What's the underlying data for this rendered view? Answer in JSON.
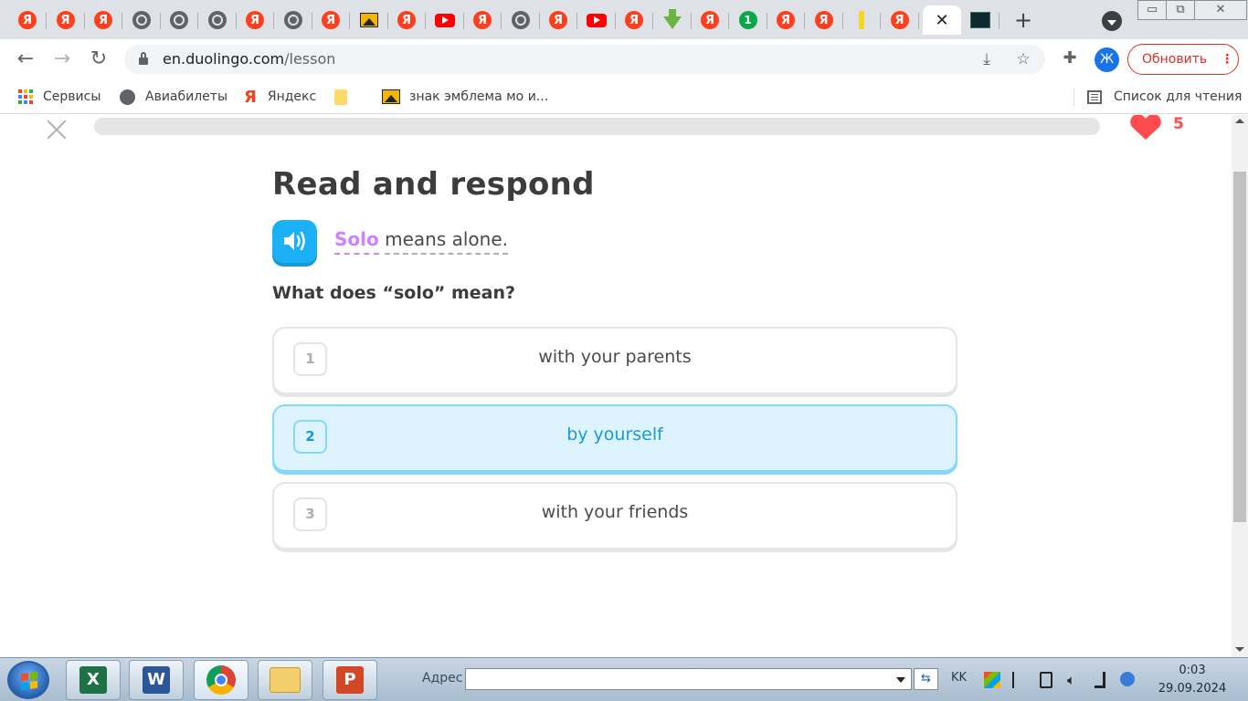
{
  "browser": {
    "tabs": [
      {
        "icon": "yandex-icon",
        "glyph": "Я"
      },
      {
        "icon": "yandex-icon",
        "glyph": "Я"
      },
      {
        "icon": "yandex-icon",
        "glyph": "Я"
      },
      {
        "icon": "globe-icon",
        "glyph": ""
      },
      {
        "icon": "globe-icon",
        "glyph": ""
      },
      {
        "icon": "globe-icon",
        "glyph": ""
      },
      {
        "icon": "yandex-icon",
        "glyph": "Я"
      },
      {
        "icon": "globe-icon",
        "glyph": ""
      },
      {
        "icon": "yandex-icon",
        "glyph": "Я"
      },
      {
        "icon": "image-icon",
        "glyph": ""
      },
      {
        "icon": "yandex-icon",
        "glyph": "Я"
      },
      {
        "icon": "youtube-icon",
        "glyph": ""
      },
      {
        "icon": "yandex-icon",
        "glyph": "Я"
      },
      {
        "icon": "globe-icon",
        "glyph": ""
      },
      {
        "icon": "yandex-icon",
        "glyph": "Я"
      },
      {
        "icon": "youtube-icon",
        "glyph": ""
      },
      {
        "icon": "yandex-icon",
        "glyph": "Я"
      },
      {
        "icon": "download-icon",
        "glyph": ""
      },
      {
        "icon": "yandex-icon",
        "glyph": "Я"
      },
      {
        "icon": "one-icon",
        "glyph": "1"
      },
      {
        "icon": "yandex-icon",
        "glyph": "Я"
      },
      {
        "icon": "yandex-icon",
        "glyph": "Я"
      },
      {
        "icon": "yellow-bar-icon",
        "glyph": ""
      },
      {
        "icon": "yandex-icon",
        "glyph": "Я"
      }
    ],
    "active_tab_close": "✕",
    "last_tab_icon": "dark-app-icon",
    "new_tab": "+",
    "window_buttons": {
      "minimize": "▭",
      "restore": "⧉",
      "close": "✕"
    },
    "url_host": "en.duolingo.com",
    "url_path": "/lesson",
    "profile_initial": "Ж",
    "update_label": "Обновить",
    "update_menu": "⋮",
    "bookmarks": [
      {
        "label": "Сервисы",
        "icon": "apps-grid-icon"
      },
      {
        "label": "Авиабилеты",
        "icon": "globe-icon"
      },
      {
        "label": "Яндекс",
        "icon": "yandex-icon",
        "glyph": "Я"
      },
      {
        "label": "",
        "icon": "folder-icon"
      },
      {
        "label": "знак эмблема мо и...",
        "icon": "image-icon"
      }
    ],
    "reading_list": "Список для чтения"
  },
  "lesson": {
    "hearts": "5",
    "progress_fraction": 0,
    "title": "Read and respond",
    "passage_highlight": "Solo",
    "passage_rest": "means alone.",
    "question": "What does “solo” mean?",
    "options": [
      {
        "num": "1",
        "label": "with your parents",
        "selected": false
      },
      {
        "num": "2",
        "label": "by yourself",
        "selected": true
      },
      {
        "num": "3",
        "label": "with your friends",
        "selected": false
      }
    ]
  },
  "taskbar": {
    "apps": [
      "excel-icon",
      "word-icon",
      "chrome-icon",
      "explorer-folder-icon",
      "powerpoint-icon"
    ],
    "app_glyphs": {
      "excel": "X",
      "word": "W",
      "powerpoint": "P"
    },
    "address_label": "Адрес",
    "address_value": "",
    "lang": "KK",
    "time": "0:03",
    "date": "29.09.2024"
  },
  "colors": {
    "accent_blue": "#1cb0f6",
    "selected_bg": "#ddf4ff",
    "highlight_purple": "#ce82ff",
    "heart_red": "#ff4b4b",
    "update_red": "#d93025"
  }
}
